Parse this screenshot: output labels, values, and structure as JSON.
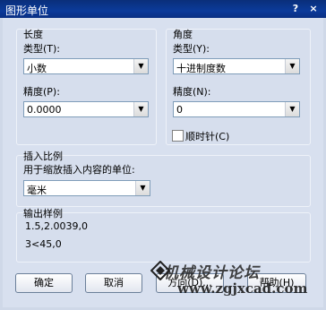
{
  "window": {
    "title": "图形单位",
    "help_glyph": "?",
    "close_glyph": "×"
  },
  "length": {
    "group_label": "长度",
    "type_label": "类型(T):",
    "type_value": "小数",
    "precision_label": "精度(P):",
    "precision_value": "0.0000"
  },
  "angle": {
    "group_label": "角度",
    "type_label": "类型(Y):",
    "type_value": "十进制度数",
    "precision_label": "精度(N):",
    "precision_value": "0",
    "clockwise_label": "顺时针(C)",
    "clockwise_checked": false
  },
  "insert_scale": {
    "group_label": "插入比例",
    "units_label": "用于缩放插入内容的单位:",
    "units_value": "毫米"
  },
  "sample_output": {
    "group_label": "输出样例",
    "line1": "1.5,2.0039,0",
    "line2": "3<45,0"
  },
  "buttons": {
    "ok": "确定",
    "cancel": "取消",
    "direction": "方向(D)...",
    "help": "帮助(H)"
  },
  "watermark": {
    "text": "机械设计论坛",
    "url": "www.zgjxcad.com"
  },
  "icons": {
    "dropdown": "chevron-down-icon"
  }
}
